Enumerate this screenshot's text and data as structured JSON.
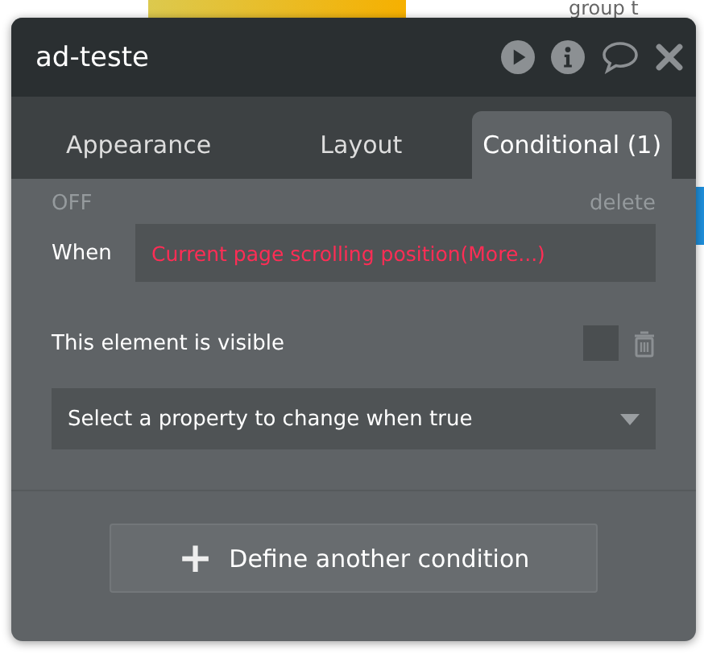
{
  "background": {
    "label": "group t"
  },
  "panel": {
    "title": "ad-teste",
    "tabs": [
      {
        "label": "Appearance",
        "selected": false
      },
      {
        "label": "Layout",
        "selected": false
      },
      {
        "label": "Conditional (1)",
        "selected": true
      }
    ],
    "status": "OFF",
    "delete_link": "delete",
    "condition": {
      "label": "When",
      "expression": "Current page scrolling position(More...)"
    },
    "property": {
      "label": "This element is visible",
      "checked": false
    },
    "select": {
      "placeholder": "Select a property to change when true"
    },
    "add_button": {
      "icon": "+",
      "label": "Define another condition"
    }
  }
}
